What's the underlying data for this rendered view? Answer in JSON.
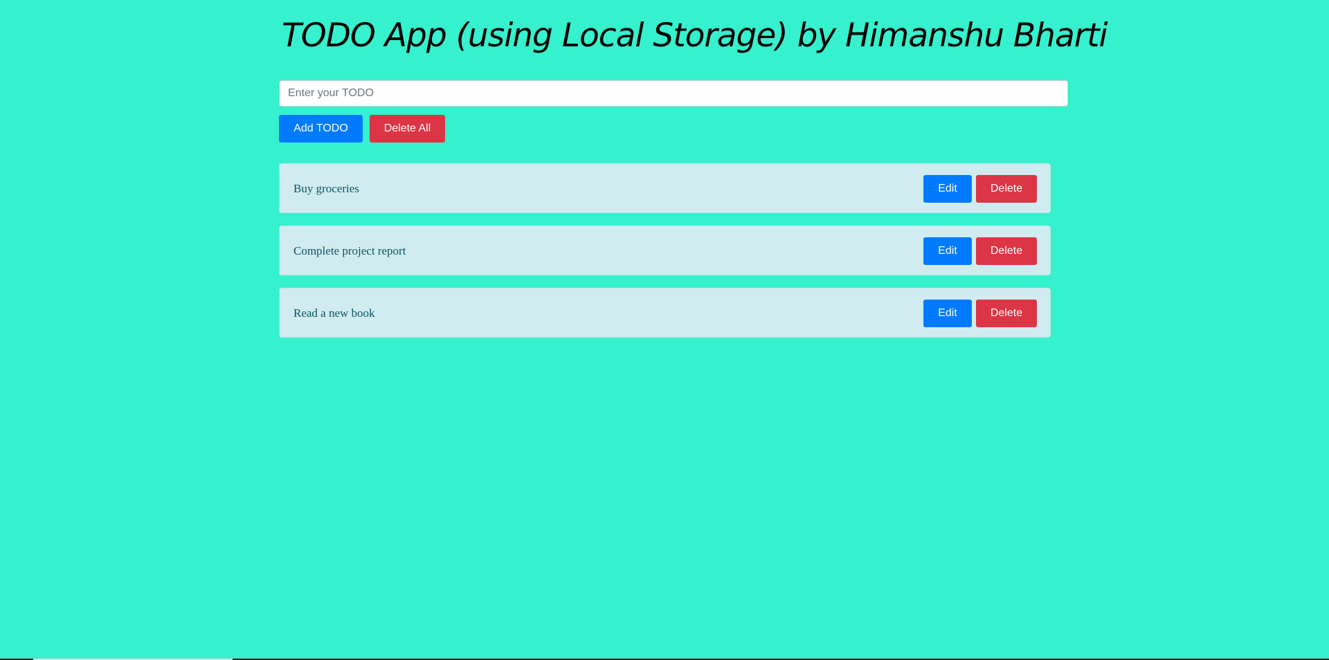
{
  "header": {
    "title": "TODO App (using Local Storage) by Himanshu Bharti"
  },
  "form": {
    "input_placeholder": "Enter your TODO",
    "input_value": "",
    "add_label": "Add TODO",
    "delete_all_label": "Delete All"
  },
  "todos": [
    {
      "text": "Buy groceries",
      "edit_label": "Edit",
      "delete_label": "Delete"
    },
    {
      "text": "Complete project report",
      "edit_label": "Edit",
      "delete_label": "Delete"
    },
    {
      "text": "Read a new book",
      "edit_label": "Edit",
      "delete_label": "Delete"
    }
  ],
  "colors": {
    "background": "#36f1cd",
    "primary": "#007bff",
    "danger": "#dc3545",
    "item_background": "#d1ecf1",
    "item_text": "#0c5460"
  }
}
